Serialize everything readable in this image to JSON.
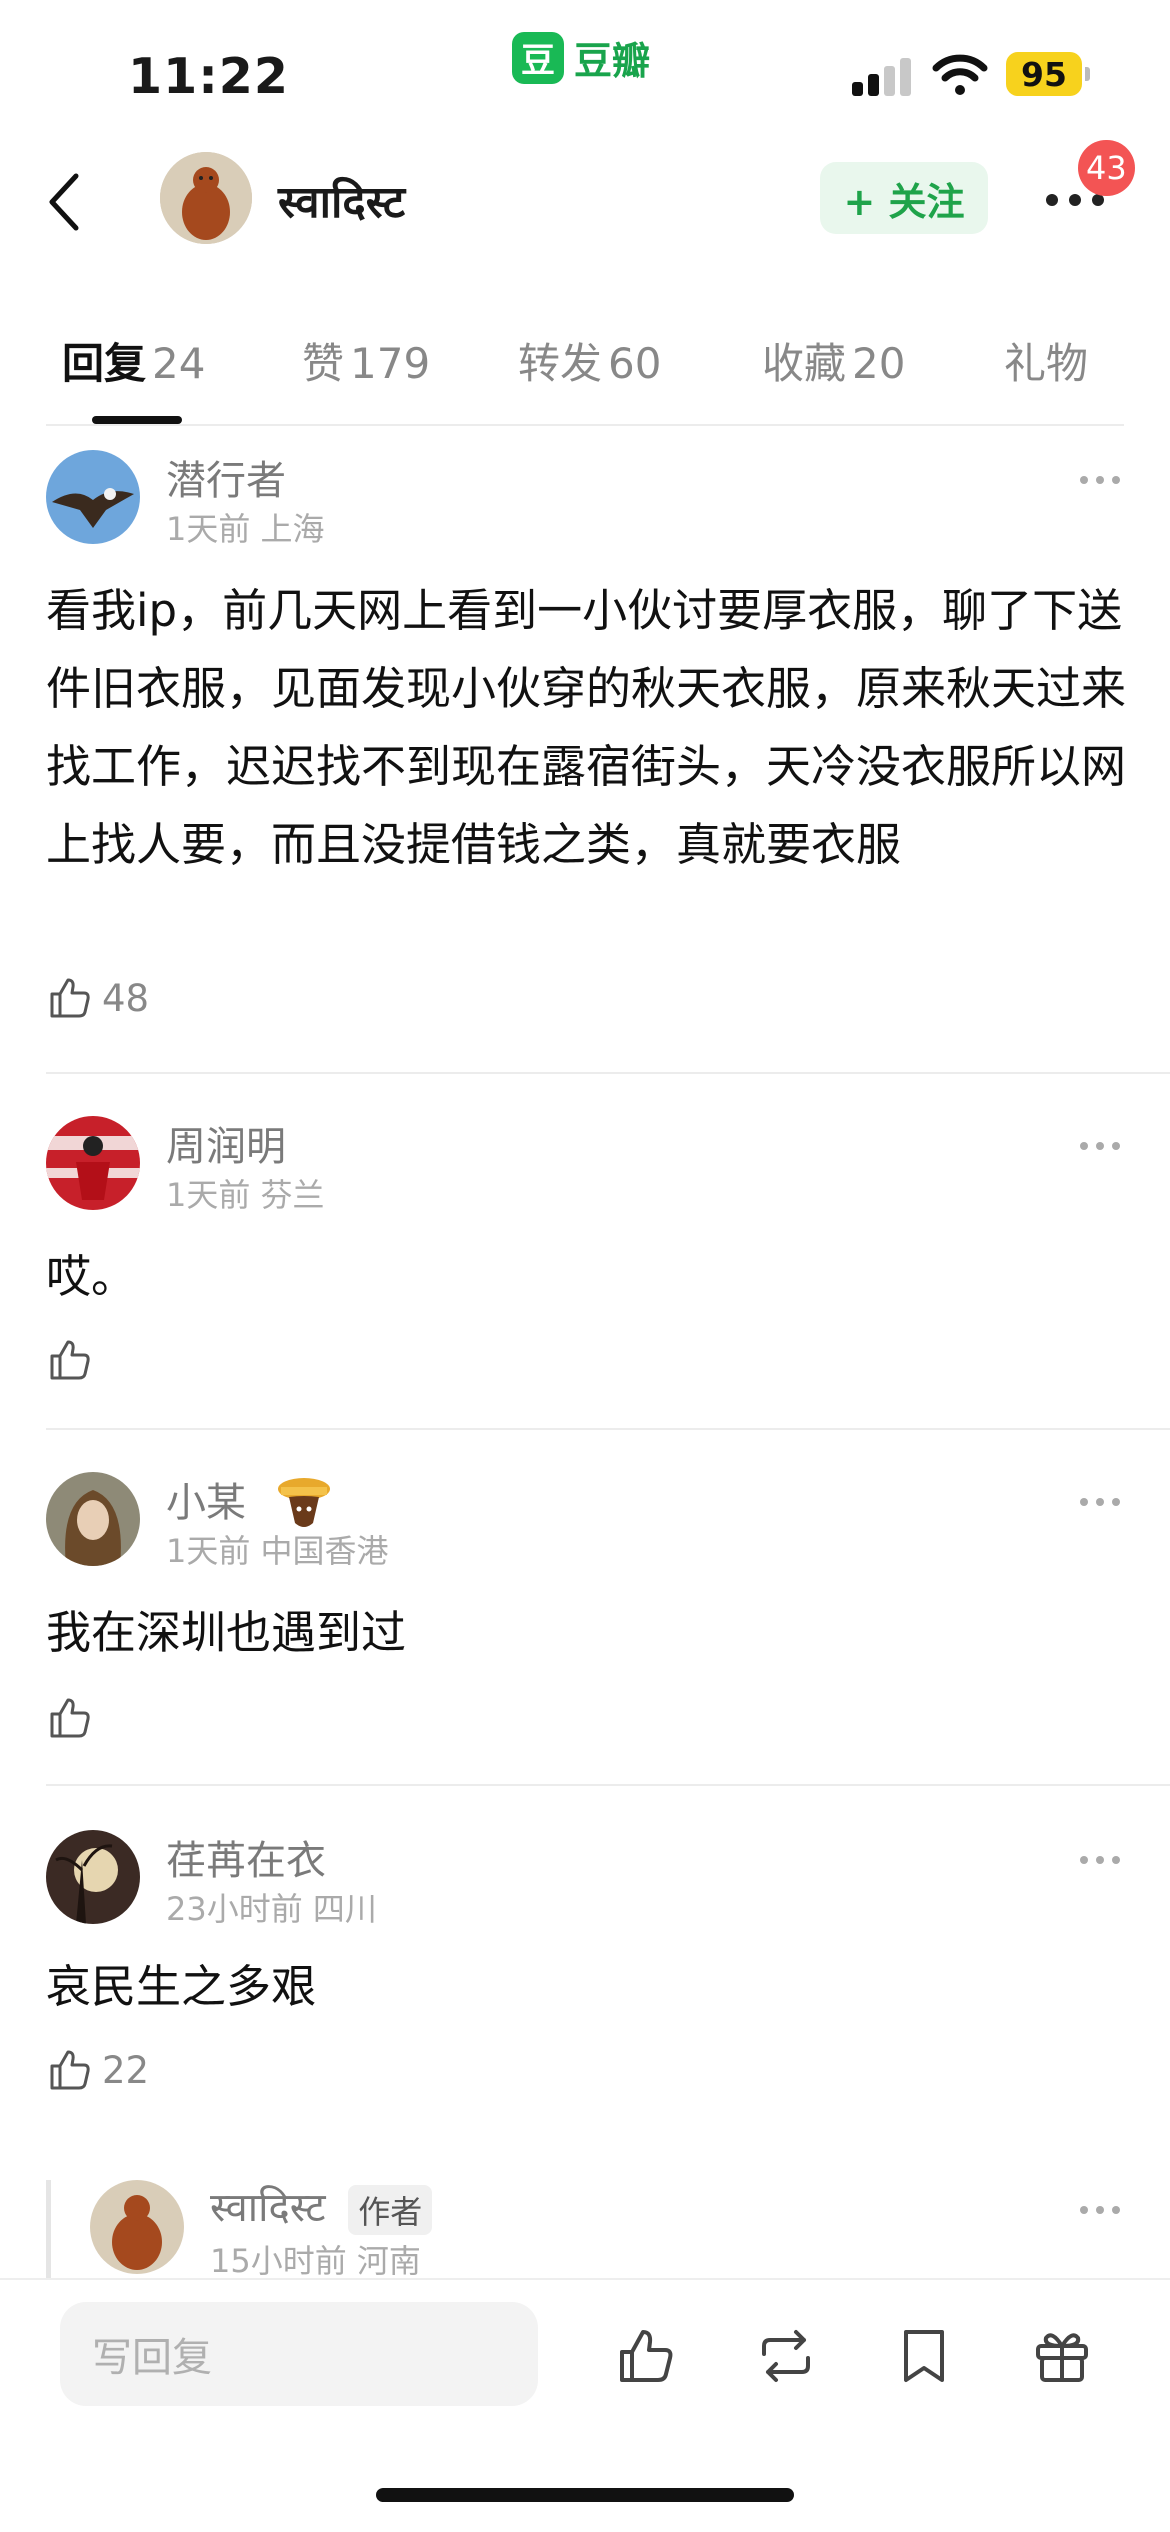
{
  "status_bar": {
    "time": "11:22",
    "app_name": "豆瓣",
    "app_logo_char": "豆",
    "battery": "95"
  },
  "header": {
    "username": "स्वादिस्ट",
    "follow_label": "+ 关注",
    "notification_count": "43"
  },
  "tabs": [
    {
      "label": "回复",
      "count": "24",
      "active": true
    },
    {
      "label": "赞",
      "count": "179"
    },
    {
      "label": "转发",
      "count": "60"
    },
    {
      "label": "收藏",
      "count": "20"
    },
    {
      "label": "礼物",
      "count": ""
    }
  ],
  "comments": [
    {
      "name": "潜行者",
      "meta": "1天前 上海",
      "text": "看我ip，前几天网上看到一小伙讨要厚衣服，聊了下送件旧衣服，见面发现小伙穿的秋天衣服，原来秋天过来找工作，迟迟找不到现在露宿街头，天冷没衣服所以网上找人要，而且没提借钱之类，真就要衣服",
      "likes": "48"
    },
    {
      "name": "周润明",
      "meta": "1天前 芬兰",
      "text": "哎。",
      "likes": ""
    },
    {
      "name": "小某",
      "meta": "1天前 中国香港",
      "text": "我在深圳也遇到过",
      "likes": ""
    },
    {
      "name": "荏苒在衣",
      "meta": "23小时前 四川",
      "text": "哀民生之多艰",
      "likes": "22"
    },
    {
      "name": "स्वादिस्ट",
      "author_tag": "作者",
      "meta": "15小时前 河南"
    }
  ],
  "bottom_bar": {
    "reply_placeholder": "写回复",
    "icons": [
      "like-icon",
      "repost-icon",
      "bookmark-icon",
      "gift-icon"
    ]
  },
  "colors": {
    "brand_green": "#19b955",
    "badge_red": "#f35454",
    "battery_yellow": "#f7d21d"
  }
}
